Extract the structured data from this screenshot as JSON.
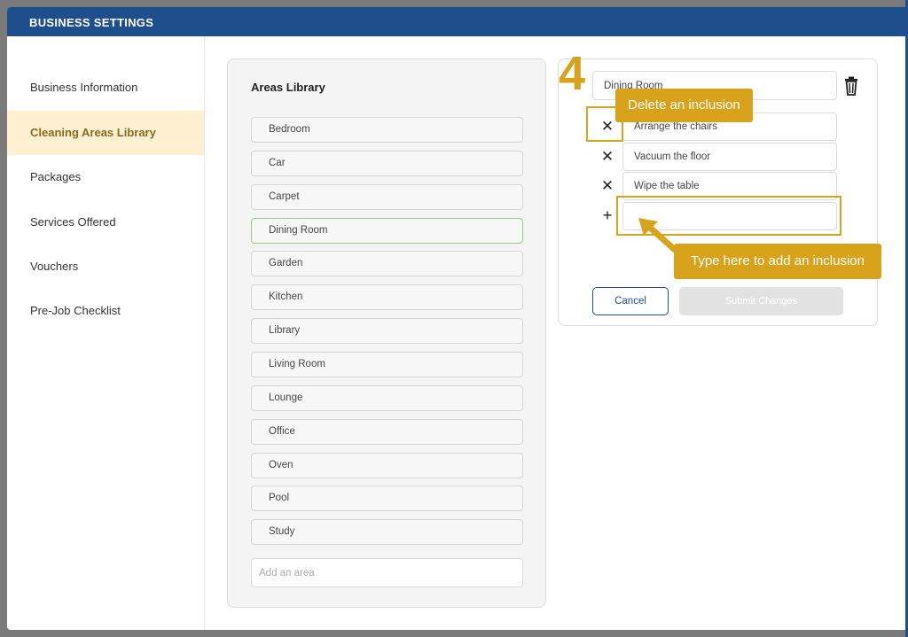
{
  "header": {
    "title": "BUSINESS SETTINGS"
  },
  "sidebar": {
    "items": [
      {
        "label": "Business Information"
      },
      {
        "label": "Cleaning Areas Library",
        "active": true
      },
      {
        "label": "Packages"
      },
      {
        "label": "Services Offered"
      },
      {
        "label": "Vouchers"
      },
      {
        "label": "Pre-Job Checklist"
      }
    ]
  },
  "library": {
    "title": "Areas Library",
    "areas": [
      "Bedroom",
      "Car",
      "Carpet",
      "Dining Room",
      "Garden",
      "Kitchen",
      "Library",
      "Living Room",
      "Lounge",
      "Office",
      "Oven",
      "Pool",
      "Study"
    ],
    "selected": "Dining Room",
    "add_placeholder": "Add an area"
  },
  "editor": {
    "area_name": "Dining Room",
    "inclusions": [
      "Arrange the chairs",
      "Vacuum the floor",
      "Wipe the table"
    ],
    "new_inclusion_value": "",
    "cancel_label": "Cancel",
    "submit_label": "Submit Changes",
    "icons": {
      "delete_area": "trash-icon",
      "remove_inclusion": "close-icon",
      "add_inclusion": "plus-icon"
    }
  },
  "tutorial": {
    "step": "4",
    "tip_delete": "Delete an inclusion",
    "tip_add": "Type here to add an inclusion",
    "accent_color": "#d9a21b"
  },
  "colors": {
    "header": "#1f4e8c",
    "active_nav_bg": "#fff0d2",
    "overlay": "#7a7a7a"
  }
}
